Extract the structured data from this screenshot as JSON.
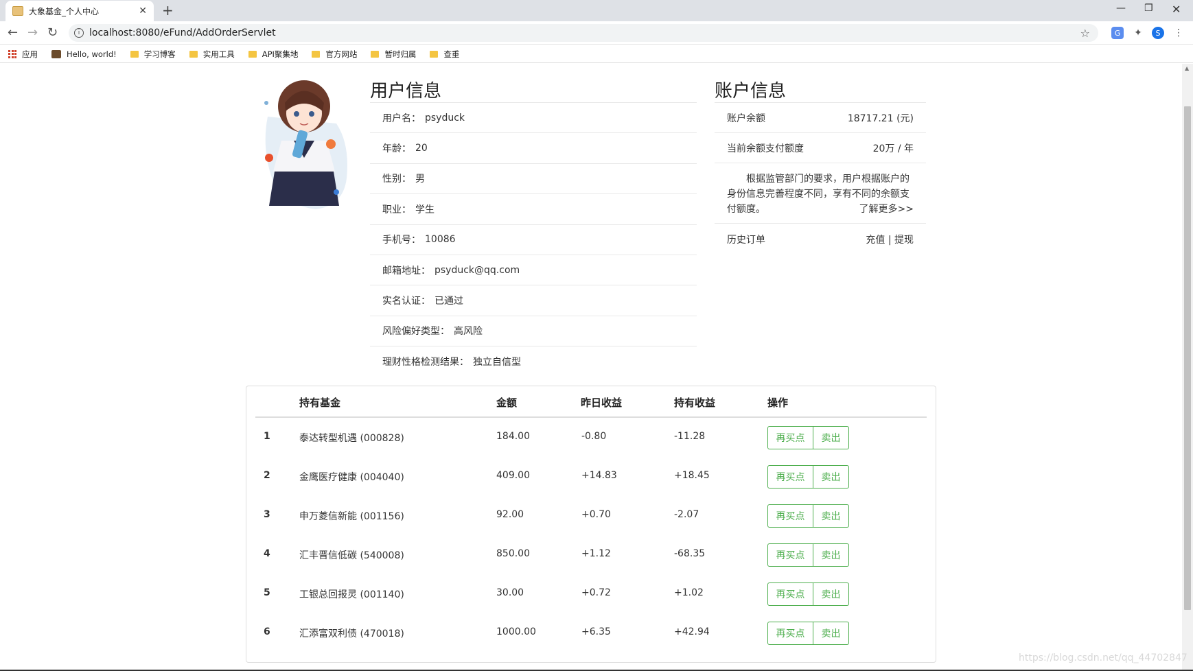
{
  "browser": {
    "tab_title": "大象基金_个人中心",
    "tab_close": "✕",
    "new_tab": "+",
    "url": "localhost:8080/eFund/AddOrderServlet",
    "profile_initial": "S"
  },
  "bookmarks": [
    {
      "label": "应用",
      "icon": "apps-icon"
    },
    {
      "label": "Hello, world!",
      "icon": "site-icon"
    },
    {
      "label": "学习博客",
      "icon": "folder-icon"
    },
    {
      "label": "实用工具",
      "icon": "folder-icon"
    },
    {
      "label": "API聚集地",
      "icon": "folder-icon"
    },
    {
      "label": "官方网站",
      "icon": "folder-icon"
    },
    {
      "label": "暂时归属",
      "icon": "folder-icon"
    },
    {
      "label": "查重",
      "icon": "folder-icon"
    }
  ],
  "user_info": {
    "title": "用户信息",
    "rows": [
      {
        "label": "用户名：",
        "value": "psyduck"
      },
      {
        "label": "年龄：",
        "value": "20"
      },
      {
        "label": "性别：",
        "value": "男"
      },
      {
        "label": "职业：",
        "value": "学生"
      },
      {
        "label": "手机号：",
        "value": "10086"
      },
      {
        "label": "邮箱地址：",
        "value": "psyduck@qq.com"
      },
      {
        "label": "实名认证：",
        "value": "已通过"
      },
      {
        "label": "风险偏好类型：",
        "value": "高风险"
      },
      {
        "label": "理财性格检测结果：",
        "value": "独立自信型"
      }
    ]
  },
  "account_info": {
    "title": "账户信息",
    "balance_label": "账户余额",
    "balance_value": "18717.21 (元)",
    "limit_label": "当前余额支付额度",
    "limit_value": "20万 / 年",
    "notice": "根据监管部门的要求，用户根据账户的身份信息完善程度不同，享有不同的余额支付额度。",
    "learn_more": "了解更多>>",
    "history_label": "历史订单",
    "recharge": "充值",
    "separator": "|",
    "withdraw": "提现"
  },
  "holdings": {
    "headers": [
      "持有基金",
      "金额",
      "昨日收益",
      "持有收益",
      "操作"
    ],
    "buy_label": "再买点",
    "sell_label": "卖出",
    "rows": [
      {
        "idx": "1",
        "fund": "泰达转型机遇 (000828)",
        "amount": "184.00",
        "yesterday": "-0.80",
        "holding": "-11.28"
      },
      {
        "idx": "2",
        "fund": "金鹰医疗健康 (004040)",
        "amount": "409.00",
        "yesterday": "+14.83",
        "holding": "+18.45"
      },
      {
        "idx": "3",
        "fund": "申万菱信新能 (001156)",
        "amount": "92.00",
        "yesterday": "+0.70",
        "holding": "-2.07"
      },
      {
        "idx": "4",
        "fund": "汇丰晋信低碳 (540008)",
        "amount": "850.00",
        "yesterday": "+1.12",
        "holding": "-68.35"
      },
      {
        "idx": "5",
        "fund": "工银总回报灵 (001140)",
        "amount": "30.00",
        "yesterday": "+0.72",
        "holding": "+1.02"
      },
      {
        "idx": "6",
        "fund": "汇添富双利债 (470018)",
        "amount": "1000.00",
        "yesterday": "+6.35",
        "holding": "+42.94"
      }
    ]
  },
  "watermark": "https://blog.csdn.net/qq_44702847"
}
